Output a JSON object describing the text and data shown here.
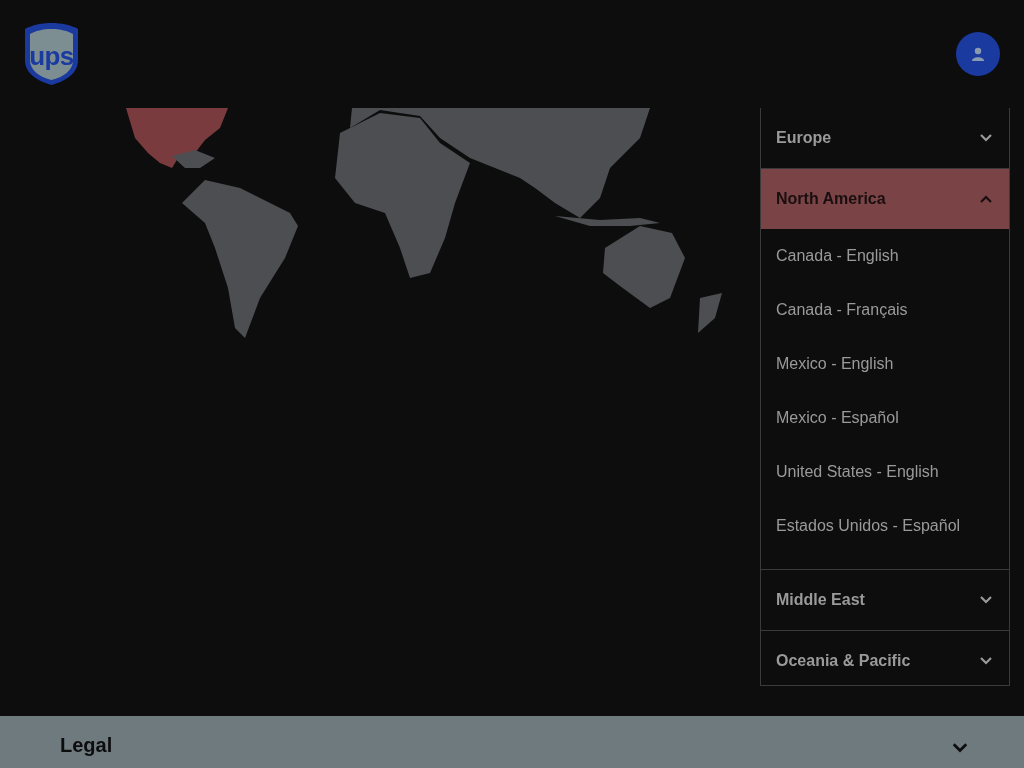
{
  "header": {
    "logo_text": "ups"
  },
  "regions": [
    {
      "label": "Europe",
      "expanded": false,
      "selected": false
    },
    {
      "label": "North America",
      "expanded": true,
      "selected": true,
      "children": [
        {
          "label": "Canada - English"
        },
        {
          "label": "Canada - Français"
        },
        {
          "label": "Mexico - English"
        },
        {
          "label": "Mexico - Español"
        },
        {
          "label": "United States - English"
        },
        {
          "label": "Estados Unidos - Español"
        }
      ]
    },
    {
      "label": "Middle East",
      "expanded": false,
      "selected": false
    },
    {
      "label": "Oceania & Pacific",
      "expanded": false,
      "selected": false
    }
  ],
  "footer": {
    "label": "Legal",
    "expanded": false
  }
}
